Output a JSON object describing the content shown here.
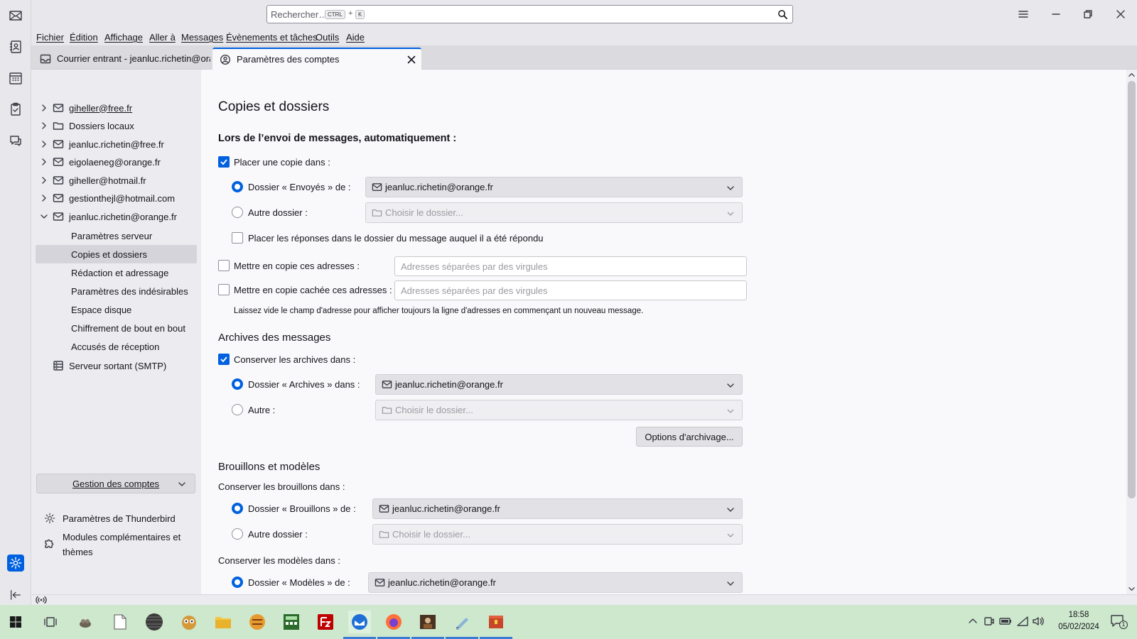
{
  "search": {
    "placeholder": "Rechercher…",
    "key1": "CTRL",
    "plus": "+",
    "key2": "K"
  },
  "menu": [
    "Fichier",
    "Édition",
    "Affichage",
    "Aller à",
    "Messages",
    "Évènements et tâches",
    "Outils",
    "Aide"
  ],
  "tabs": [
    {
      "label": "Courrier entrant - jeanluc.richetin@orange.fr"
    },
    {
      "label": "Paramètres des comptes"
    }
  ],
  "sidebar": {
    "accounts": [
      {
        "label": "giheller@free.fr"
      },
      {
        "label": "Dossiers locaux"
      },
      {
        "label": "jeanluc.richetin@free.fr"
      },
      {
        "label": "eigolaeneg@orange.fr"
      },
      {
        "label": "giheller@hotmail.fr"
      },
      {
        "label": "gestionthejl@hotmail.com"
      },
      {
        "label": "jeanluc.richetin@orange.fr"
      }
    ],
    "subitems": [
      {
        "label": "Paramètres serveur"
      },
      {
        "label": "Copies et dossiers"
      },
      {
        "label": "Rédaction et adressage"
      },
      {
        "label": "Paramètres des indésirables"
      },
      {
        "label": "Espace disque"
      },
      {
        "label": "Chiffrement de bout en bout"
      },
      {
        "label": "Accusés de réception"
      }
    ],
    "smtp": "Serveur sortant (SMTP)",
    "manage": "Gestion des comptes",
    "settings": "Paramètres de Thunderbird",
    "addons_line1": "Modules complémentaires et",
    "addons_line2": "thèmes"
  },
  "main": {
    "title": "Copies et dossiers",
    "sending": {
      "heading": "Lors de l’envoi de messages, automatiquement :",
      "place_copy": "Placer une copie dans :",
      "sent_folder_label": "Dossier « Envoyés » de :",
      "sent_folder_value": "jeanluc.richetin@orange.fr",
      "other_folder_label": "Autre dossier :",
      "choose_folder": "Choisir le dossier...",
      "replies_label": "Placer les réponses dans le dossier du message auquel il a été répondu",
      "cc_label": "Mettre en copie ces adresses :",
      "bcc_label": "Mettre en copie cachée ces adresses :",
      "addr_placeholder": "Adresses séparées par des virgules",
      "hint": "Laissez vide le champ d'adresse pour afficher toujours la ligne d'adresses en commençant un nouveau message."
    },
    "archives": {
      "heading": "Archives des messages",
      "keep": "Conserver les archives dans :",
      "folder_label": "Dossier « Archives » dans :",
      "folder_value": "jeanluc.richetin@orange.fr",
      "other_label": "Autre :",
      "choose_folder": "Choisir le dossier...",
      "options_button": "Options d'archivage..."
    },
    "drafts": {
      "heading": "Brouillons et modèles",
      "keep_drafts": "Conserver les brouillons dans :",
      "drafts_label": "Dossier « Brouillons » de :",
      "drafts_value": "jeanluc.richetin@orange.fr",
      "other_label": "Autre dossier :",
      "choose_folder": "Choisir le dossier...",
      "keep_templates": "Conserver les modèles dans :",
      "templates_label": "Dossier « Modèles » de :",
      "templates_value": "jeanluc.richetin@orange.fr"
    }
  },
  "taskbar": {
    "time": "18:58",
    "date": "05/02/2024",
    "notifications": "1"
  },
  "colors": {
    "accent": "#0061e0",
    "taskbar": "#cde8cd"
  }
}
